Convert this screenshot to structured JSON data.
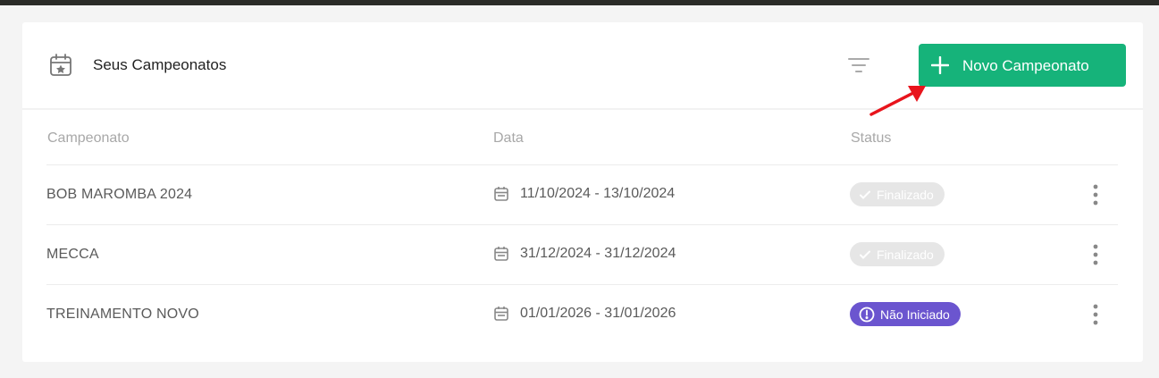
{
  "header": {
    "title": "Seus Campeonatos",
    "new_button_label": "Novo Campeonato",
    "icon": "calendar-star-icon",
    "filter_icon": "filter-icon"
  },
  "table": {
    "columns": [
      "Campeonato",
      "Data",
      "Status"
    ],
    "rows": [
      {
        "name": "BOB MAROMBA 2024",
        "date": "11/10/2024 - 13/10/2024",
        "status": "Finalizado",
        "status_type": "done"
      },
      {
        "name": "MECCA",
        "date": "31/12/2024 - 31/12/2024",
        "status": "Finalizado",
        "status_type": "done"
      },
      {
        "name": "TREINAMENTO NOVO",
        "date": "01/01/2026 - 31/01/2026",
        "status": "Não Iniciado",
        "status_type": "todo"
      }
    ]
  },
  "colors": {
    "accent": "#16b37a",
    "status_todo": "#6b55cf",
    "status_done": "#e6e6e6",
    "annotation_arrow": "#e8141c"
  }
}
